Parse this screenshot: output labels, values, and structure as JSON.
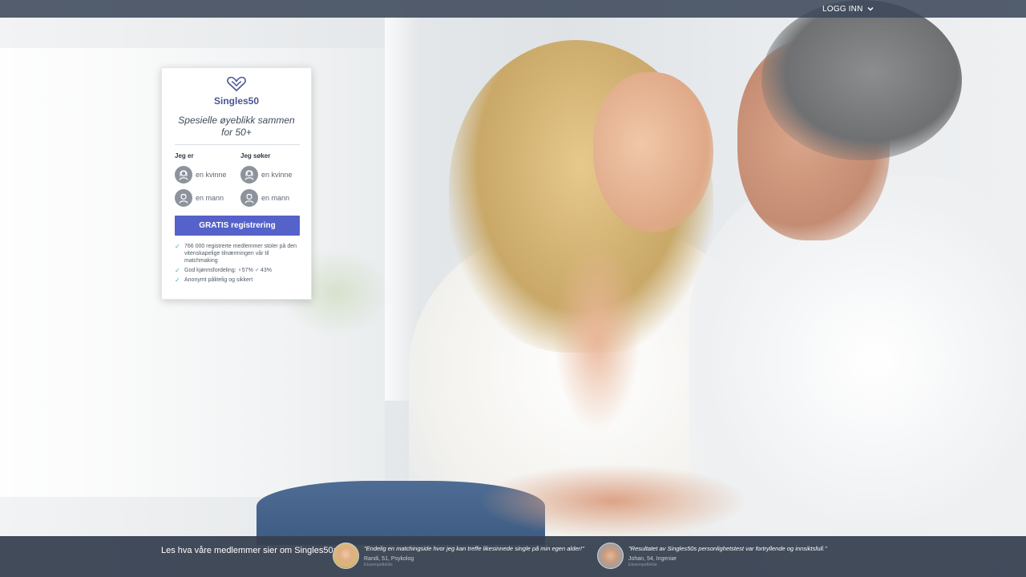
{
  "topbar": {
    "login_label": "LOGG INN"
  },
  "card": {
    "brand": "Singles50",
    "tagline": "Spesielle øyeblikk sammen for 50+",
    "i_am_label": "Jeg er",
    "seeking_label": "Jeg søker",
    "i_am_options": [
      {
        "label": "en kvinne",
        "icon": "woman-avatar-icon"
      },
      {
        "label": "en mann",
        "icon": "man-avatar-icon"
      }
    ],
    "seeking_options": [
      {
        "label": "en kvinne",
        "icon": "woman-avatar-icon"
      },
      {
        "label": "en mann",
        "icon": "man-avatar-icon"
      }
    ],
    "cta_label": "GRATIS registrering",
    "bullets": [
      "766 000 registrerte medlemmer stoler på den vitenskapelige tilnærmingen vår til matchmaking",
      "God kjønnsfordeling: ♀57% ♂ 43%",
      "Anonymt pålitelig og sikkert"
    ]
  },
  "footer": {
    "title": "Les hva våre medlemmer sier om Singles50:",
    "testimonials": [
      {
        "quote": "\"Endelig en matchingside hvor jeg kan treffe likesinnede single på min egen alder!\"",
        "author": "Randi, 51, Psykolog",
        "caption": "Eksempelbilde"
      },
      {
        "quote": "\"Resultatet av Singles50s personlighetstest var fortryllende og innsiktsfull.\"",
        "author": "Johan, 54, Ingeniør",
        "caption": "Eksempelbilde"
      }
    ]
  },
  "colors": {
    "brand": "#4b5593",
    "cta": "#5562c9",
    "check": "#4aa9a6",
    "bar": "#364050"
  }
}
